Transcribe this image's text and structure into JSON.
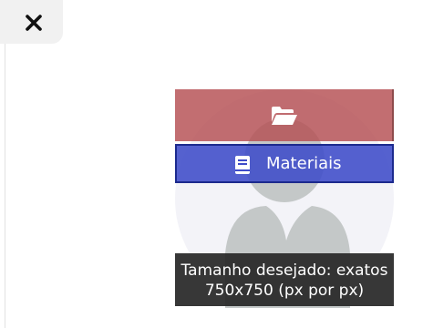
{
  "tooltip": {
    "line1": "Tamanho desejado: exatos",
    "line2": "750x750 (px por px)"
  },
  "materials_button": {
    "label": "Materiais"
  },
  "icons": {
    "close": "close-icon",
    "upload": "folder-open-icon",
    "materials": "book-icon",
    "avatar": "avatar-placeholder-icon"
  },
  "colors": {
    "upload_button": "#b44e52",
    "materials_button": "#3e4bc8",
    "tooltip_bg": "#282828"
  }
}
